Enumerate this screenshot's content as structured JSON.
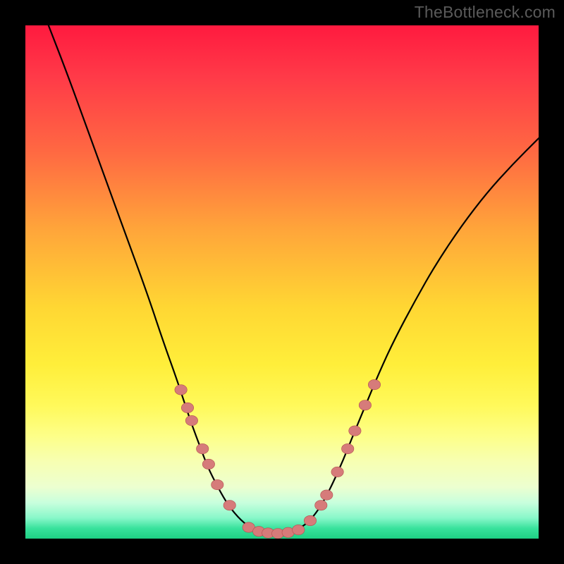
{
  "watermark": "TheBottleneck.com",
  "colors": {
    "frame": "#000000",
    "watermark": "#5a5a5a",
    "curve": "#000000",
    "dot_fill": "#d67b7a",
    "dot_stroke": "#b24f4e",
    "gradient_top": "#ff1a3f",
    "gradient_bottom": "#1ed084"
  },
  "chart_data": {
    "type": "line",
    "title": "",
    "xlabel": "",
    "ylabel": "",
    "xlim": [
      0,
      100
    ],
    "ylim": [
      0,
      100
    ],
    "note": "No axes or tick labels visible; values are positions read off the plot as percentages of the plot area (0,0 = top-left).",
    "curve_xy_pct": [
      [
        4.5,
        0.0
      ],
      [
        8.0,
        9.0
      ],
      [
        12.0,
        20.0
      ],
      [
        16.0,
        31.0
      ],
      [
        20.0,
        42.0
      ],
      [
        24.0,
        53.0
      ],
      [
        27.0,
        62.0
      ],
      [
        29.5,
        69.0
      ],
      [
        31.0,
        73.5
      ],
      [
        32.5,
        78.0
      ],
      [
        34.0,
        82.0
      ],
      [
        35.5,
        86.0
      ],
      [
        37.5,
        90.0
      ],
      [
        39.5,
        93.5
      ],
      [
        42.0,
        96.5
      ],
      [
        44.5,
        98.3
      ],
      [
        47.0,
        99.0
      ],
      [
        50.0,
        99.0
      ],
      [
        52.5,
        98.5
      ],
      [
        55.0,
        97.0
      ],
      [
        57.0,
        94.5
      ],
      [
        58.5,
        92.0
      ],
      [
        60.0,
        89.0
      ],
      [
        62.0,
        84.5
      ],
      [
        64.0,
        79.5
      ],
      [
        66.5,
        73.5
      ],
      [
        69.0,
        67.5
      ],
      [
        72.0,
        61.0
      ],
      [
        76.0,
        53.5
      ],
      [
        80.0,
        46.5
      ],
      [
        85.0,
        39.0
      ],
      [
        90.0,
        32.5
      ],
      [
        95.0,
        27.0
      ],
      [
        100.0,
        22.0
      ]
    ],
    "dots_xy_pct": [
      [
        30.3,
        71.0
      ],
      [
        31.6,
        74.5
      ],
      [
        32.4,
        77.0
      ],
      [
        34.5,
        82.5
      ],
      [
        35.7,
        85.5
      ],
      [
        37.4,
        89.5
      ],
      [
        39.8,
        93.5
      ],
      [
        43.5,
        97.8
      ],
      [
        45.5,
        98.6
      ],
      [
        47.3,
        98.9
      ],
      [
        49.2,
        99.0
      ],
      [
        51.2,
        98.8
      ],
      [
        53.2,
        98.3
      ],
      [
        55.5,
        96.5
      ],
      [
        57.6,
        93.5
      ],
      [
        58.7,
        91.5
      ],
      [
        60.8,
        87.0
      ],
      [
        62.8,
        82.5
      ],
      [
        64.2,
        79.0
      ],
      [
        66.2,
        74.0
      ],
      [
        68.0,
        70.0
      ]
    ],
    "dot_radius_pct": 1.2
  }
}
